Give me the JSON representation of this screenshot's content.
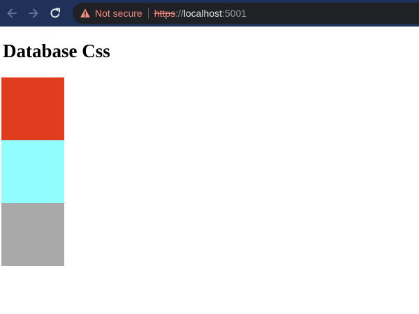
{
  "browser": {
    "toolbar_color": "#1f3158",
    "nav_icons": [
      "arrow-left-icon",
      "arrow-right-icon",
      "reload-icon"
    ],
    "omnibox": {
      "security_icon": "warning-triangle-icon",
      "security_label": "Not secure",
      "url_scheme": "https",
      "url_separator": "://",
      "url_host": "localhost",
      "url_port": ":5001"
    }
  },
  "page": {
    "title": "Database Css",
    "boxes": [
      {
        "color": "#e03c1e"
      },
      {
        "color": "#91fdff"
      },
      {
        "color": "#a9a9a9"
      }
    ]
  }
}
